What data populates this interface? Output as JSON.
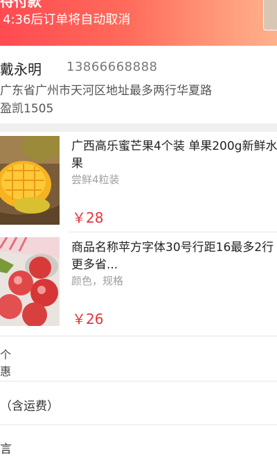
{
  "header": {
    "status_title": "待付款",
    "countdown": "4:36后订单将自动取消"
  },
  "address": {
    "name": "戴永明",
    "phone": "13866668888",
    "line1": "广东省广州市天河区地址最多两行华夏路",
    "line2": "盈凯1505"
  },
  "products": [
    {
      "name": "广西高乐蜜芒果4个装 单果200g新鲜水果",
      "spec": "尝鲜4粒装",
      "price": "￥28",
      "image_icon": "mango-image"
    },
    {
      "name": "商品名称苹方字体30号行距16最多2行更多省...",
      "spec": "颜色，规格",
      "price": "￥26",
      "image_icon": "apple-image"
    }
  ],
  "summary": {
    "count_label": "个",
    "discount_label": "惠",
    "total_label": "（含运费）",
    "message_label": "言"
  },
  "colors": {
    "banner_start": "#ff4a52",
    "banner_end": "#ffb08c",
    "price": "#e8323c"
  }
}
